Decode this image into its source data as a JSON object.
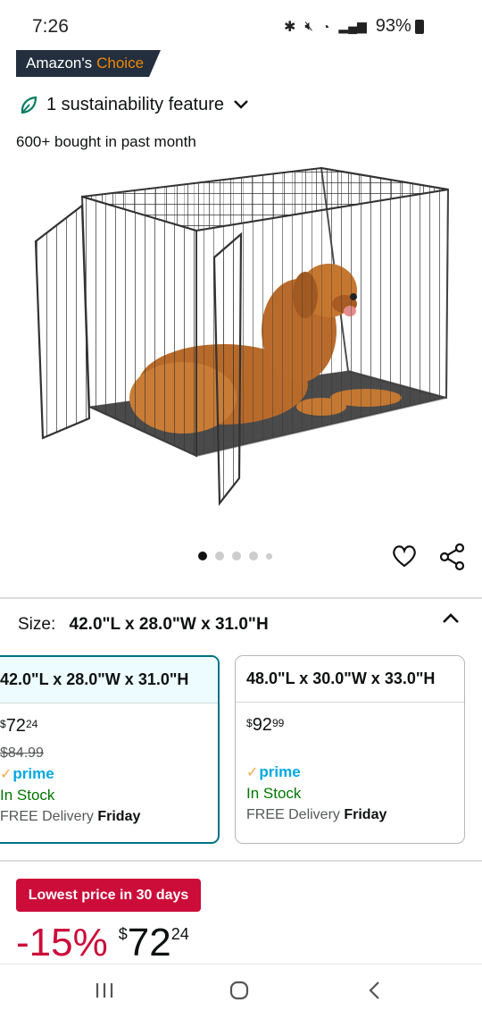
{
  "status": {
    "time": "7:26",
    "battery": "93%"
  },
  "badge": {
    "prefix": "Amazon's",
    "accent": "Choice"
  },
  "sustainability": {
    "label": "1 sustainability feature"
  },
  "social_proof": "600+ bought in past month",
  "carousel": {
    "count": 5,
    "active": 0
  },
  "size": {
    "label": "Size:",
    "value": "42.0\"L x 28.0\"W x 31.0\"H"
  },
  "options": [
    {
      "title": "42.0\"L x 28.0\"W x 31.0\"H",
      "price_currency": "$",
      "price_whole": "72",
      "price_fraction": "24",
      "list_price": "$84.99",
      "prime": "prime",
      "stock": "In Stock",
      "delivery_prefix": "FREE Delivery",
      "delivery_day": "Friday"
    },
    {
      "title": "48.0\"L x 30.0\"W x 33.0\"H",
      "price_currency": "$",
      "price_whole": "92",
      "price_fraction": "99",
      "prime": "prime",
      "stock": "In Stock",
      "delivery_prefix": "FREE Delivery",
      "delivery_day": "Friday"
    }
  ],
  "deal": {
    "badge": "Lowest price in 30 days",
    "discount": "-15%",
    "currency": "$",
    "whole": "72",
    "fraction": "24"
  },
  "colors": {
    "deal_red": "#cc0c39",
    "selected_teal": "#007185",
    "stock_green": "#007600",
    "badge_navy": "#232f3e",
    "choice_orange": "#f08804"
  }
}
